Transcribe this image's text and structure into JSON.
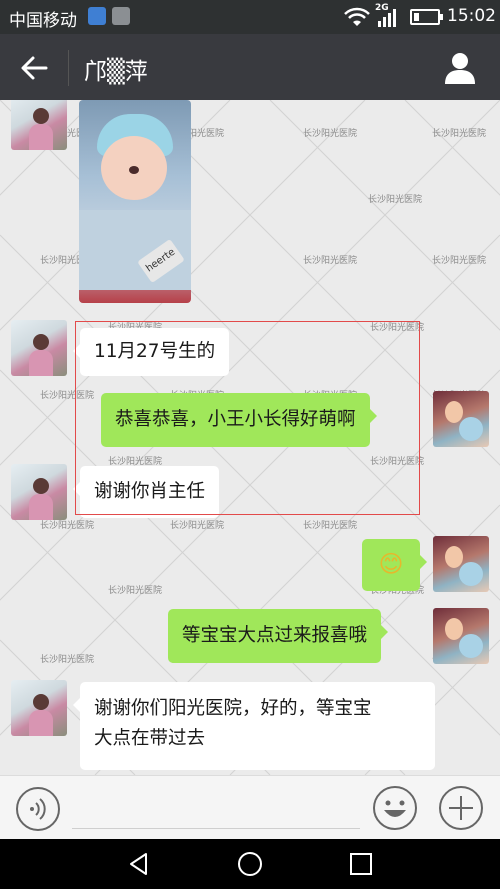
{
  "status_bar": {
    "carrier": "中国移动",
    "network": "2G",
    "time": "15:02"
  },
  "header": {
    "title": "邝▒萍"
  },
  "watermark": "长沙阳光医院",
  "photo_tag": "heerte",
  "messages": [
    {
      "side": "left",
      "type": "image"
    },
    {
      "side": "left",
      "type": "text",
      "text": "11月27号生的"
    },
    {
      "side": "right",
      "type": "text",
      "text": "恭喜恭喜，小王小长得好萌啊"
    },
    {
      "side": "left",
      "type": "text",
      "text": "谢谢你肖主任"
    },
    {
      "side": "right",
      "type": "emoji",
      "text": "😊"
    },
    {
      "side": "right",
      "type": "text",
      "text": "等宝宝大点过来报喜哦"
    },
    {
      "side": "left",
      "type": "text",
      "lines": [
        "谢谢你们阳光医院，好的，等宝宝",
        "大点在带过去"
      ]
    }
  ],
  "colors": {
    "outgoing_bubble": "#a0e75a",
    "incoming_bubble": "#ffffff",
    "nav_bar": "#393a3f",
    "highlight_box": "#e24a4a"
  }
}
